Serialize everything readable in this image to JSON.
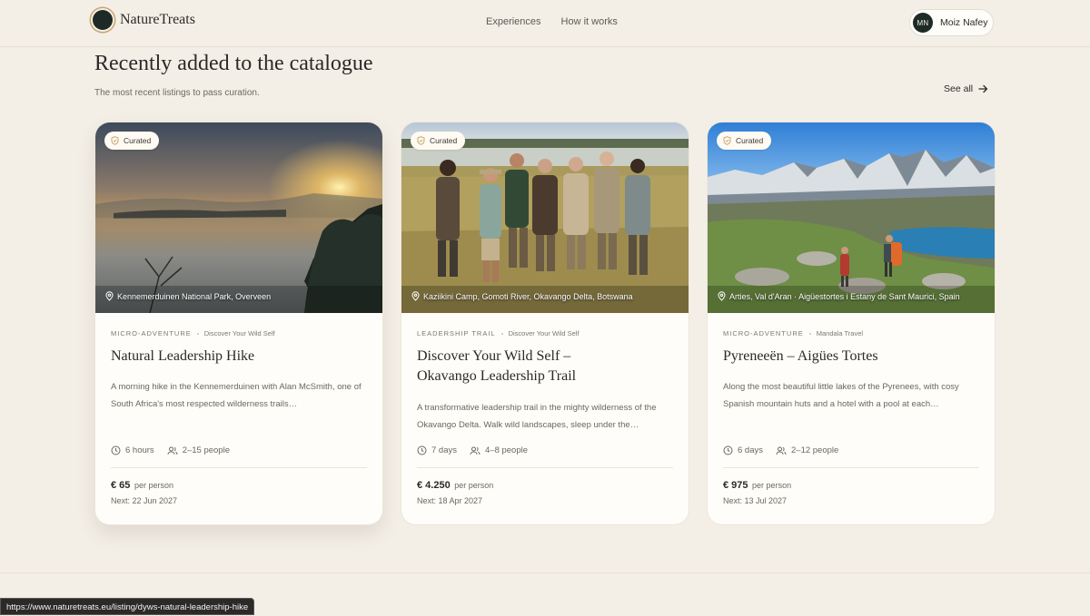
{
  "header": {
    "brand": "NatureTreats",
    "nav": [
      "Experiences",
      "How it works"
    ],
    "user": {
      "initials": "MN",
      "name": "Moiz Nafey"
    }
  },
  "section": {
    "title": "Recently added to the catalogue",
    "subtitle": "The most recent listings to pass curation.",
    "see_all": "See all"
  },
  "cards": [
    {
      "badge": "Curated",
      "location": "Kennemerduinen National Park, Overveen",
      "type": "Micro-adventure",
      "provider": "Discover Your Wild Self",
      "title_lines": [
        "Natural Leadership Hike"
      ],
      "description": "A morning hike in the Kennemerduinen with Alan McSmith, one of South Africa's most respected wilderness trails…",
      "duration": "6 hours",
      "group": "2–15 people",
      "price": "€ 65",
      "price_unit": "per person",
      "next": "Next: 22 Jun 2027"
    },
    {
      "badge": "Curated",
      "location": "Kaziikini Camp, Gomoti River, Okavango Delta, Botswana",
      "type": "Leadership trail",
      "provider": "Discover Your Wild Self",
      "title_lines": [
        "Discover Your Wild Self –",
        "Okavango Leadership Trail"
      ],
      "description": "A transformative leadership trail in the mighty wilderness of the Okavango Delta. Walk wild landscapes, sleep under the…",
      "duration": "7 days",
      "group": "4–8 people",
      "price": "€ 4.250",
      "price_unit": "per person",
      "next": "Next: 18 Apr 2027"
    },
    {
      "badge": "Curated",
      "location": "Arties, Val d'Aran · Aigüestortes i Estany de Sant Maurici, Spain",
      "type": "Micro-adventure",
      "provider": "Mandala Travel",
      "title_lines": [
        "Pyreneeën – Aigües Tortes"
      ],
      "description": "Along the most beautiful little lakes of the Pyrenees, with cosy Spanish mountain huts and a hotel with a pool at each…",
      "duration": "6 days",
      "group": "2–12 people",
      "price": "€ 975",
      "price_unit": "per person",
      "next": "Next: 13 Jul 2027"
    }
  ],
  "status_url": "https://www.naturetreats.eu/listing/dyws-natural-leadership-hike",
  "colors": {
    "background": "#f4efe6",
    "card": "#fffdf9",
    "brand_dark": "#1e2a25",
    "accent_gold": "#c9a56b"
  }
}
